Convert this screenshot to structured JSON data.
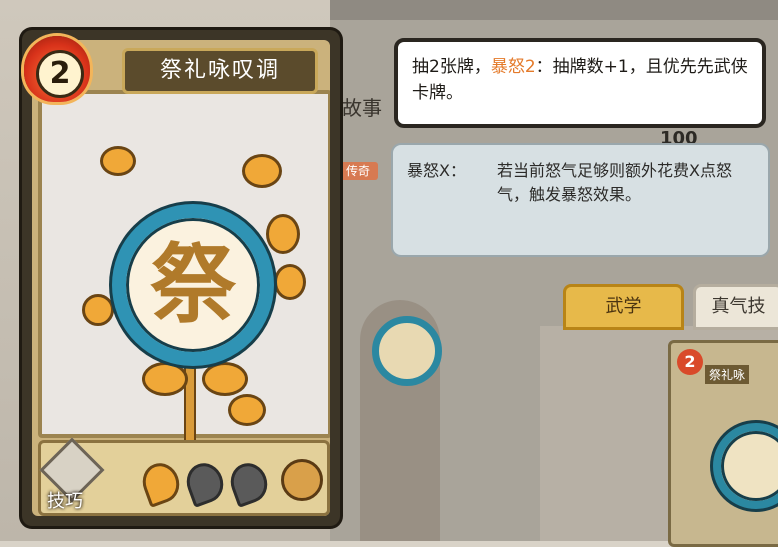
{
  "card": {
    "name": "祭礼咏叹调",
    "cost": "2",
    "emblem_glyph": "祭",
    "type_label": "技巧",
    "rage_pips": [
      "on",
      "off",
      "off"
    ]
  },
  "tooltip_primary": {
    "part1": "抽2张牌，",
    "highlight": "暴怒2",
    "part2": "：抽牌数+1，且优先先武侠卡牌。"
  },
  "tooltip_keyword": {
    "term": "暴怒X：",
    "description": "若当前怒气足够则额外花费X点怒气，触发暴怒效果。"
  },
  "background": {
    "story_label": "故事",
    "legend_badge": "传奇",
    "number": "100",
    "tab_active": "武学",
    "tab_other": "真气技",
    "small_card_cost": "2",
    "small_card_title": "祭礼咏"
  },
  "colors": {
    "highlight": "#e47a2a",
    "ring": "#2f93b4",
    "gold": "#f0a838"
  }
}
